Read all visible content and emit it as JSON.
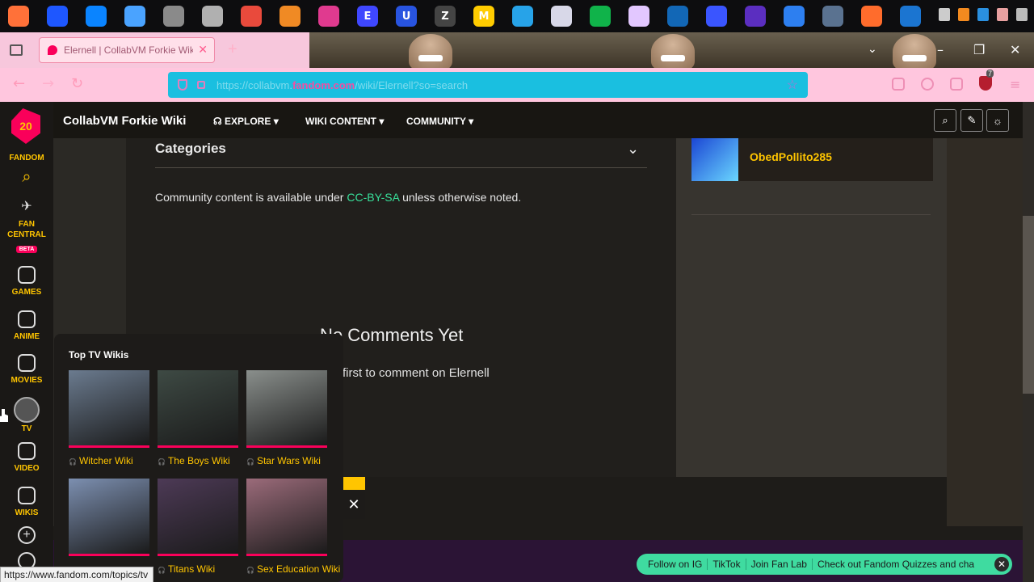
{
  "taskbar": {
    "apps": [
      {
        "name": "firefox-icon",
        "color": "#ff7139",
        "glyph": ""
      },
      {
        "name": "firefox-blue-icon",
        "color": "#1e57ff",
        "glyph": ""
      },
      {
        "name": "firefox-alt-icon",
        "color": "#0a84ff",
        "glyph": ""
      },
      {
        "name": "waterfox-icon",
        "color": "#4aa3ff",
        "glyph": ""
      },
      {
        "name": "raccoon-browser-icon",
        "color": "#8a8a8a",
        "glyph": ""
      },
      {
        "name": "raccoon-alt-icon",
        "color": "#b0b0b0",
        "glyph": ""
      },
      {
        "name": "fox-red-icon",
        "color": "#e94a3c",
        "glyph": ""
      },
      {
        "name": "fox-orange-icon",
        "color": "#f08a24",
        "glyph": ""
      },
      {
        "name": "fox-pink-icon",
        "color": "#e03a8f",
        "glyph": ""
      },
      {
        "name": "letter-e-icon",
        "color": "#3f47ff",
        "glyph": "E"
      },
      {
        "name": "letter-u-icon",
        "color": "#2854e0",
        "glyph": "U"
      },
      {
        "name": "letter-z-icon",
        "color": "#444",
        "glyph": "Z"
      },
      {
        "name": "letter-m-icon",
        "color": "#ffcc00",
        "glyph": "M"
      },
      {
        "name": "swirl-icon",
        "color": "#27a3e8",
        "glyph": ""
      },
      {
        "name": "white-orb-icon",
        "color": "#d8d8e8",
        "glyph": ""
      },
      {
        "name": "green-orb-icon",
        "color": "#10b34a",
        "glyph": ""
      },
      {
        "name": "rainbow-icon",
        "color": "#e2c7ff",
        "glyph": ""
      },
      {
        "name": "globe-icon",
        "color": "#1267b6",
        "glyph": ""
      },
      {
        "name": "blue-orb-icon",
        "color": "#3a55ff",
        "glyph": ""
      },
      {
        "name": "purple-app-icon",
        "color": "#5b2ec0",
        "glyph": ""
      },
      {
        "name": "blue-leaf-icon",
        "color": "#2d7ff0",
        "glyph": ""
      },
      {
        "name": "gray-orb-icon",
        "color": "#5a7290",
        "glyph": ""
      },
      {
        "name": "firefox-orange-icon",
        "color": "#ff6c2c",
        "glyph": ""
      },
      {
        "name": "edge-icon",
        "color": "#1b75d1",
        "glyph": ""
      }
    ],
    "tray": [
      "#cccccc",
      "#f28a1f",
      "#2a90e0",
      "#e8a0a0",
      "#bbbbbb"
    ]
  },
  "browser": {
    "tab_title": "Elernell | CollabVM Forkie Wiki",
    "url_host": "fandom.com",
    "url_prefix": "https://collabvm.",
    "url_path": "/wiki/Elernell?so=search",
    "extension_count": "7"
  },
  "sidebar": {
    "logo_number": "20",
    "items": [
      {
        "label": "FANDOM",
        "name": "sidebar-item-fandom"
      },
      {
        "label": "FAN CENTRAL",
        "name": "sidebar-item-fan-central"
      },
      {
        "label": "GAMES",
        "name": "sidebar-item-games"
      },
      {
        "label": "ANIME",
        "name": "sidebar-item-anime"
      },
      {
        "label": "MOVIES",
        "name": "sidebar-item-movies"
      },
      {
        "label": "TV",
        "name": "sidebar-item-tv"
      },
      {
        "label": "VIDEO",
        "name": "sidebar-item-video"
      },
      {
        "label": "WIKIS",
        "name": "sidebar-item-wikis"
      }
    ],
    "beta_label": "BETA"
  },
  "wiki_header": {
    "wiki_name": "CollabVM Forkie Wiki",
    "explore": "EXPLORE",
    "wiki_content": "WIKI CONTENT",
    "community": "COMMUNITY"
  },
  "article": {
    "categories_title": "Categories",
    "license_prefix": "Community content is available under ",
    "license_link": "CC-BY-SA",
    "license_suffix": " unless otherwise noted."
  },
  "comments": {
    "title": "No Comments Yet",
    "subtitle": "first to comment on Elernell"
  },
  "rail": {
    "user_name": "ObedPollito285"
  },
  "flyout": {
    "title": "Top TV Wikis",
    "wikis": [
      {
        "label": "Witcher Wiki",
        "color": "#6b7b8f"
      },
      {
        "label": "The Boys Wiki",
        "color": "#3e4a44"
      },
      {
        "label": "Star Wars Wiki",
        "color": "#8a8f8c"
      },
      {
        "label": "",
        "color": "#7c8fb0"
      },
      {
        "label": "Titans Wiki",
        "color": "#4d3a56"
      },
      {
        "label": "Sex Education Wiki",
        "color": "#9b6b7a"
      }
    ]
  },
  "social_bar": {
    "items": [
      "Follow on IG",
      "TikTok",
      "Join Fan Lab",
      "Check out Fandom Quizzes and cha"
    ]
  },
  "status_url": "https://www.fandom.com/topics/tv",
  "colors": {
    "fandom_pink": "#fa005a",
    "fandom_yellow": "#ffc500",
    "link_green": "#38e09a"
  }
}
